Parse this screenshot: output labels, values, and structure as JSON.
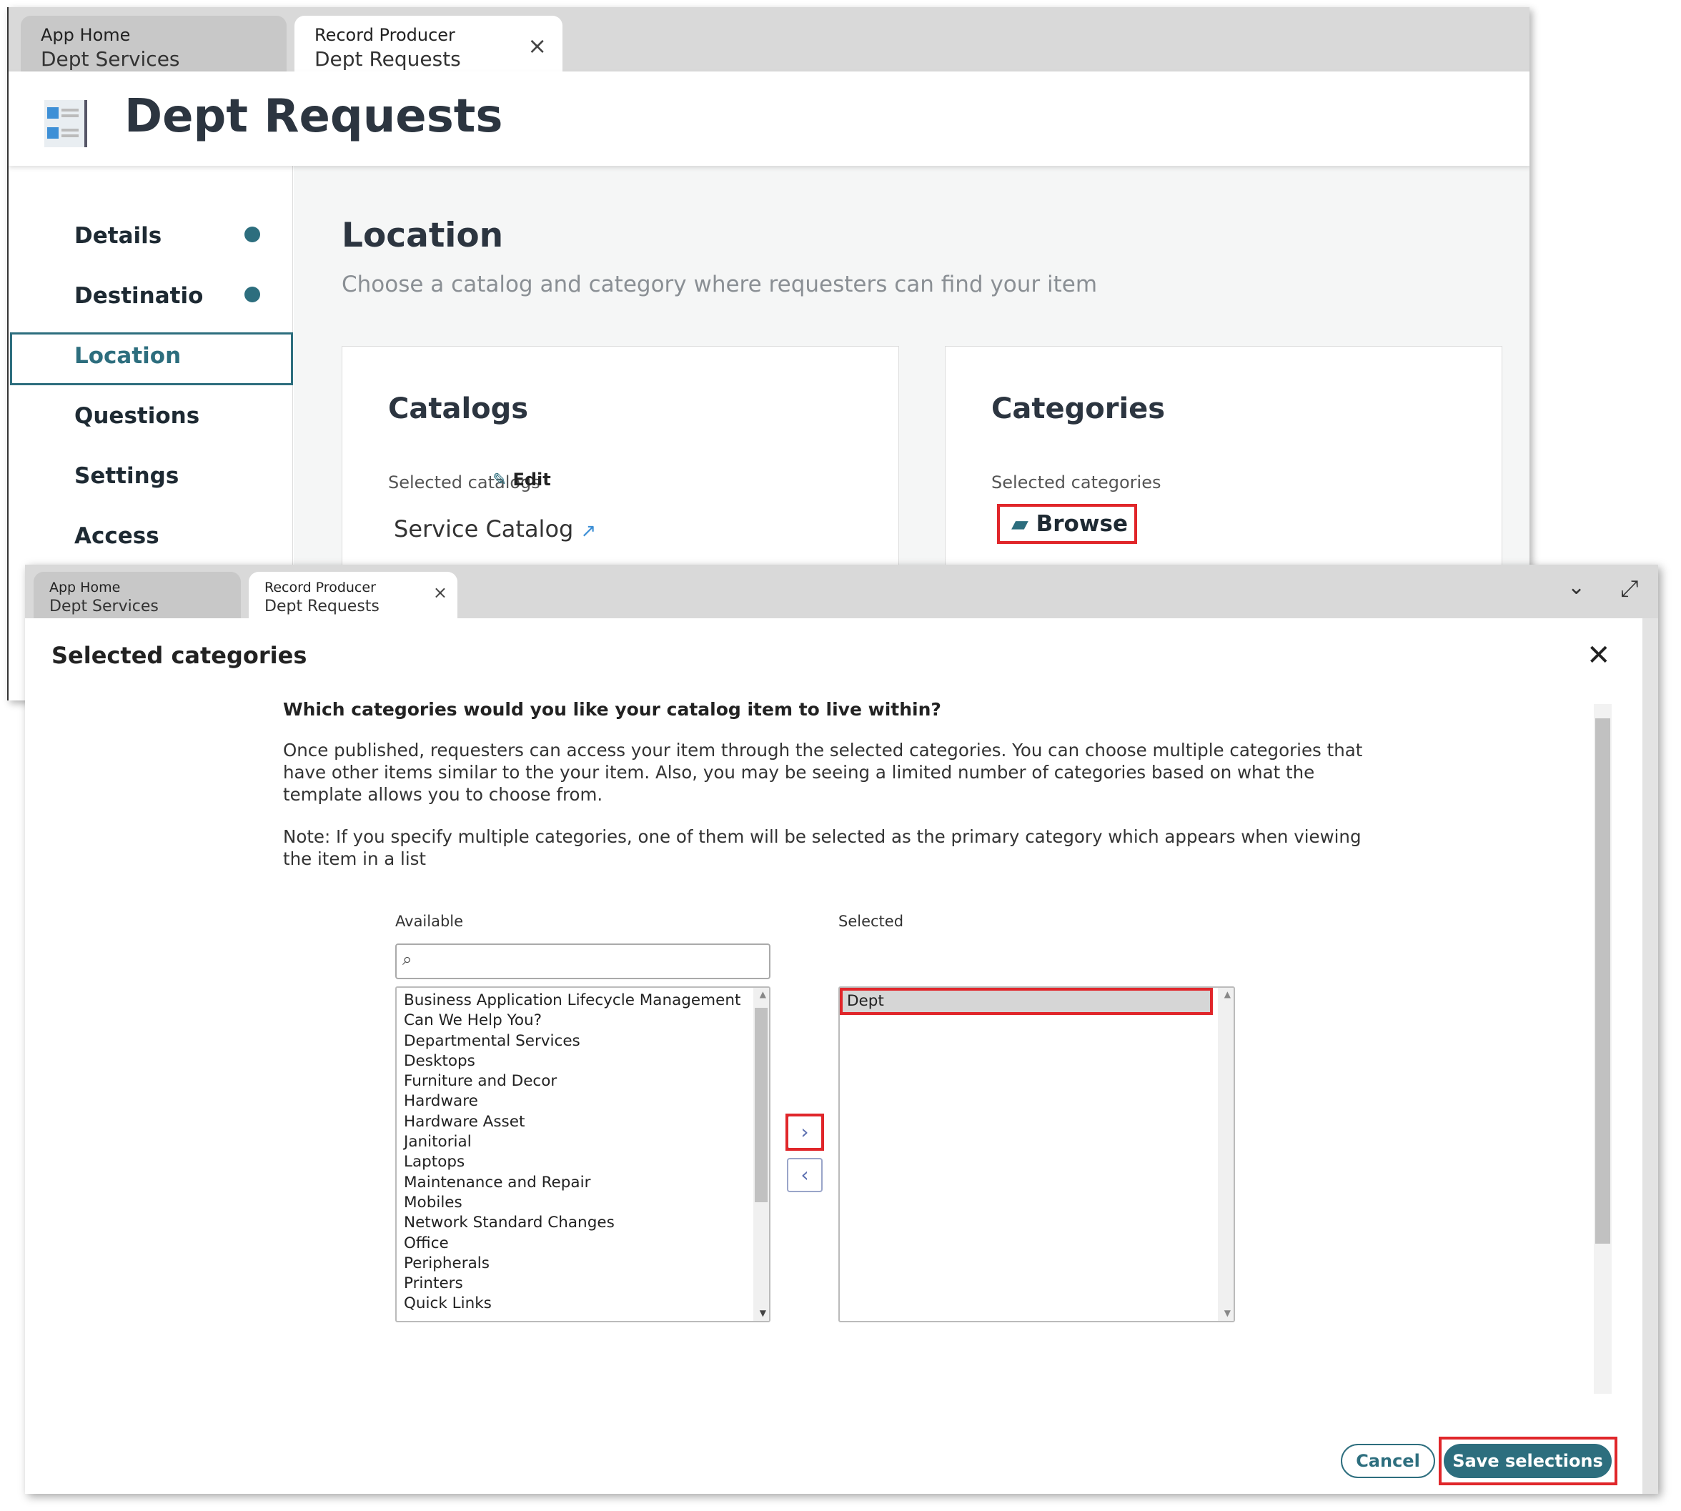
{
  "background_window": {
    "tabs": [
      {
        "line1": "App Home",
        "line2": "Dept Services"
      },
      {
        "line1": "Record Producer",
        "line2": "Dept Requests",
        "close": "×"
      }
    ],
    "page_title": "Dept Requests",
    "sidebar": {
      "items": [
        {
          "label": "Details",
          "complete": true
        },
        {
          "label": "Destinatio",
          "complete": true
        },
        {
          "label": "Location",
          "selected": true
        },
        {
          "label": "Questions"
        },
        {
          "label": "Settings"
        },
        {
          "label": "Access"
        }
      ]
    },
    "section": {
      "title": "Location",
      "subtitle": "Choose a catalog and category where requesters can find your item"
    },
    "catalogs_card": {
      "title": "Catalogs",
      "selected_label": "Selected catalogs",
      "edit_label": "Edit",
      "catalog_value": "Service Catalog"
    },
    "categories_card": {
      "title": "Categories",
      "selected_label": "Selected categories",
      "browse_label": "Browse"
    }
  },
  "modal": {
    "tabs": [
      {
        "line1": "App Home",
        "line2": "Dept Services"
      },
      {
        "line1": "Record Producer",
        "line2": "Dept Requests",
        "close": "×"
      }
    ],
    "title": "Selected categories",
    "question": "Which categories would you like your catalog item to live within?",
    "paragraph": "Once published, requesters can access your item through the selected categories. You can choose multiple categories that have other items similar to the your item. Also, you may be seeing a limited number of categories based on what the template allows you to choose from.",
    "note": "Note: If you specify multiple categories, one of them will be selected as the primary category which appears when viewing the item in a list",
    "available_label": "Available",
    "search_placeholder": "",
    "available_items": [
      "Business Application Lifecycle Management",
      "Can We Help You?",
      "Departmental Services",
      "Desktops",
      "Furniture and Decor",
      "Hardware",
      "Hardware Asset",
      "Janitorial",
      "Laptops",
      "Maintenance and Repair",
      "Mobiles",
      "Network Standard Changes",
      "Office",
      "Peripherals",
      "Printers",
      "Quick Links"
    ],
    "selected_label": "Selected",
    "selected_items": [
      "Dept"
    ],
    "add_button": "›",
    "remove_button": "‹",
    "cancel_label": "Cancel",
    "save_label": "Save selections"
  },
  "colors": {
    "accent": "#2d6e7e",
    "highlight": "#e0262a"
  }
}
